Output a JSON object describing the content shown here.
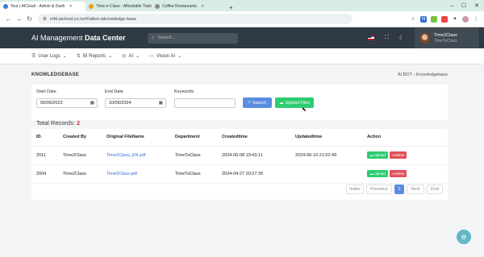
{
  "browser": {
    "tabs": [
      {
        "title": "Tour | AICloud - Admin & Dash",
        "fav_color": "#3a7bd5"
      },
      {
        "title": "Time-n-Class - Affordable Train",
        "fav_color": "#e6a020"
      },
      {
        "title": "Coffee Restaurants",
        "fav_color": "#888888"
      }
    ],
    "url": "mfd.aicloud.co.nz/#/aibot-aiknowledge-base"
  },
  "header": {
    "brand_prefix": "AI Management ",
    "brand_bold": "Data Center",
    "search_placeholder": "Search...",
    "user_name": "Time2Class",
    "user_sub": "TimeToClass"
  },
  "menu": [
    "User Logs",
    "BI Reports",
    "AI",
    "Vision AI"
  ],
  "page": {
    "title": "KNOWLEDGEBASE",
    "breadcrumb": "AI BOT  ›  Knowledgebase"
  },
  "filter": {
    "start_label": "Start Date",
    "start_value": "09/06/2023",
    "end_label": "End Date",
    "end_value": "10/06/2024",
    "keywords_label": "Keywords",
    "keywords_value": "",
    "search_label": "Search",
    "upload_label": "Upload Files"
  },
  "records": {
    "label": "Total Records: ",
    "count": "2"
  },
  "table": {
    "headers": [
      "ID.",
      "Created By",
      "Original FileName",
      "Department",
      "Createdtime",
      "Updatedtime",
      "Action"
    ],
    "rows": [
      {
        "id": "2011",
        "created_by": "Time2Class",
        "file": "Time2Class_EN.pdf",
        "dept": "TimeToClass",
        "created": "2024-06-08 19:43:11",
        "updated": "2024-06-10 21:52:49"
      },
      {
        "id": "2004",
        "created_by": "Time2Class",
        "file": "Time2Class.pdf",
        "dept": "TimeToClass",
        "created": "2024-04-27 20:27:39",
        "updated": ""
      }
    ],
    "upload_btn": "Upload",
    "delete_btn": "Delete"
  },
  "pager": [
    "Index",
    "Previous",
    "1",
    "Next",
    "End"
  ],
  "colors": {
    "primary": "#5b8de0",
    "success": "#2ecc71",
    "danger": "#e2505a",
    "header": "#2f3a44"
  }
}
